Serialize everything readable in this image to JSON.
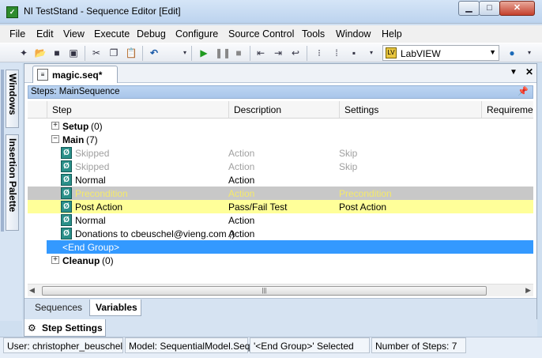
{
  "window": {
    "title": "NI TestStand - Sequence Editor [Edit]",
    "app_icon": "teststand-icon"
  },
  "menu": [
    "File",
    "Edit",
    "View",
    "Execute",
    "Debug",
    "Configure",
    "Source Control",
    "Tools",
    "Window",
    "Help"
  ],
  "toolbar": {
    "adapter": "LabVIEW"
  },
  "left_dock": {
    "tabs": [
      "Windows",
      "Insertion Palette"
    ]
  },
  "document": {
    "tab_label": "magic.seq*",
    "steps_header": "Steps: MainSequence",
    "columns": [
      "Step",
      "Description",
      "Settings",
      "Requirement"
    ],
    "rows": [
      {
        "kind": "group",
        "expander": "+",
        "name": "Setup",
        "count": "(0)"
      },
      {
        "kind": "group",
        "expander": "−",
        "name": "Main",
        "count": "(7)"
      },
      {
        "kind": "step",
        "name": "Skipped",
        "description": "Action",
        "settings": "Skip",
        "style": "disabled"
      },
      {
        "kind": "step",
        "name": "Skipped",
        "description": "Action",
        "settings": "Skip",
        "style": "disabled"
      },
      {
        "kind": "step",
        "name": "Normal",
        "description": "Action",
        "settings": "",
        "style": "normal"
      },
      {
        "kind": "step",
        "name": "Precondition",
        "description": "Action",
        "settings": "Precondition",
        "style": "precondition"
      },
      {
        "kind": "step",
        "name": "Post Action",
        "description": "Pass/Fail Test",
        "settings": "Post Action",
        "style": "post-action"
      },
      {
        "kind": "step",
        "name": "Normal",
        "description": "Action",
        "settings": "",
        "style": "normal"
      },
      {
        "kind": "step",
        "name": "Donations to cbeuschel@vieng.com  ;)",
        "description": "Action",
        "settings": "",
        "style": "normal"
      },
      {
        "kind": "end",
        "name": "<End Group>",
        "style": "selected"
      },
      {
        "kind": "group",
        "expander": "+",
        "name": "Cleanup",
        "count": "(0)"
      }
    ],
    "bottom_tabs": [
      "Sequences",
      "Variables"
    ],
    "active_bottom_tab": "Variables"
  },
  "step_settings": {
    "label": "Step Settings"
  },
  "status": {
    "user": "User: christopher_beuschel",
    "model": "Model: SequentialModel.Seq",
    "selection": "'<End Group>' Selected",
    "count": "Number of Steps: 7"
  },
  "colors": {
    "selected_row": "#3399ff",
    "precondition_row": "#c8c8c8",
    "precondition_text": "#f5e96a",
    "post_action_row": "#ffff99",
    "disabled_text": "#a0a0a0"
  }
}
